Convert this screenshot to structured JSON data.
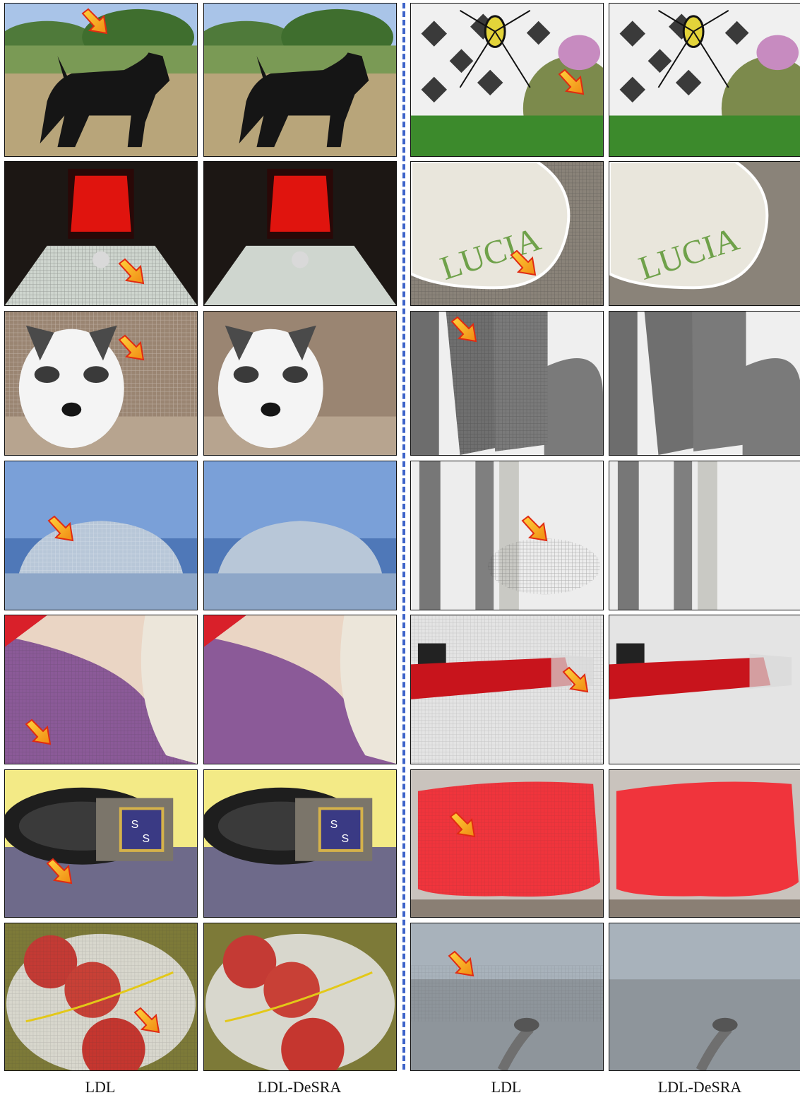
{
  "captions": [
    "LDL",
    "LDL-DeSRA",
    "LDL",
    "LDL-DeSRA"
  ],
  "patch_text": {
    "lucia": "LUCIA",
    "badge_left": "S",
    "badge_right": "S"
  },
  "colors": {
    "divider": "#3d63c9",
    "arrow_fill": "#f6a21a",
    "arrow_stroke": "#e02b12"
  }
}
